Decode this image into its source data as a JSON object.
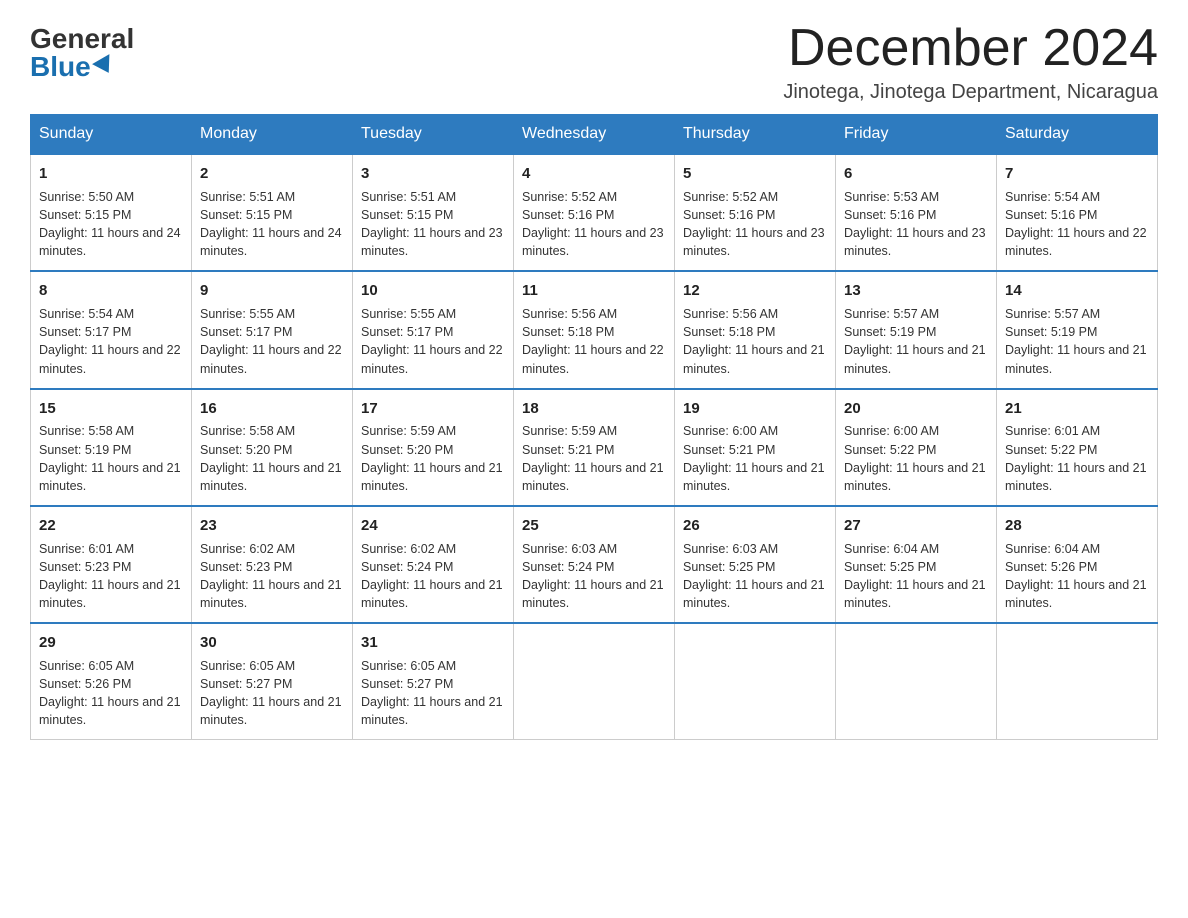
{
  "logo": {
    "general": "General",
    "blue": "Blue"
  },
  "title": "December 2024",
  "location": "Jinotega, Jinotega Department, Nicaragua",
  "days_of_week": [
    "Sunday",
    "Monday",
    "Tuesday",
    "Wednesday",
    "Thursday",
    "Friday",
    "Saturday"
  ],
  "weeks": [
    [
      {
        "day": "1",
        "sunrise": "5:50 AM",
        "sunset": "5:15 PM",
        "daylight": "11 hours and 24 minutes."
      },
      {
        "day": "2",
        "sunrise": "5:51 AM",
        "sunset": "5:15 PM",
        "daylight": "11 hours and 24 minutes."
      },
      {
        "day": "3",
        "sunrise": "5:51 AM",
        "sunset": "5:15 PM",
        "daylight": "11 hours and 23 minutes."
      },
      {
        "day": "4",
        "sunrise": "5:52 AM",
        "sunset": "5:16 PM",
        "daylight": "11 hours and 23 minutes."
      },
      {
        "day": "5",
        "sunrise": "5:52 AM",
        "sunset": "5:16 PM",
        "daylight": "11 hours and 23 minutes."
      },
      {
        "day": "6",
        "sunrise": "5:53 AM",
        "sunset": "5:16 PM",
        "daylight": "11 hours and 23 minutes."
      },
      {
        "day": "7",
        "sunrise": "5:54 AM",
        "sunset": "5:16 PM",
        "daylight": "11 hours and 22 minutes."
      }
    ],
    [
      {
        "day": "8",
        "sunrise": "5:54 AM",
        "sunset": "5:17 PM",
        "daylight": "11 hours and 22 minutes."
      },
      {
        "day": "9",
        "sunrise": "5:55 AM",
        "sunset": "5:17 PM",
        "daylight": "11 hours and 22 minutes."
      },
      {
        "day": "10",
        "sunrise": "5:55 AM",
        "sunset": "5:17 PM",
        "daylight": "11 hours and 22 minutes."
      },
      {
        "day": "11",
        "sunrise": "5:56 AM",
        "sunset": "5:18 PM",
        "daylight": "11 hours and 22 minutes."
      },
      {
        "day": "12",
        "sunrise": "5:56 AM",
        "sunset": "5:18 PM",
        "daylight": "11 hours and 21 minutes."
      },
      {
        "day": "13",
        "sunrise": "5:57 AM",
        "sunset": "5:19 PM",
        "daylight": "11 hours and 21 minutes."
      },
      {
        "day": "14",
        "sunrise": "5:57 AM",
        "sunset": "5:19 PM",
        "daylight": "11 hours and 21 minutes."
      }
    ],
    [
      {
        "day": "15",
        "sunrise": "5:58 AM",
        "sunset": "5:19 PM",
        "daylight": "11 hours and 21 minutes."
      },
      {
        "day": "16",
        "sunrise": "5:58 AM",
        "sunset": "5:20 PM",
        "daylight": "11 hours and 21 minutes."
      },
      {
        "day": "17",
        "sunrise": "5:59 AM",
        "sunset": "5:20 PM",
        "daylight": "11 hours and 21 minutes."
      },
      {
        "day": "18",
        "sunrise": "5:59 AM",
        "sunset": "5:21 PM",
        "daylight": "11 hours and 21 minutes."
      },
      {
        "day": "19",
        "sunrise": "6:00 AM",
        "sunset": "5:21 PM",
        "daylight": "11 hours and 21 minutes."
      },
      {
        "day": "20",
        "sunrise": "6:00 AM",
        "sunset": "5:22 PM",
        "daylight": "11 hours and 21 minutes."
      },
      {
        "day": "21",
        "sunrise": "6:01 AM",
        "sunset": "5:22 PM",
        "daylight": "11 hours and 21 minutes."
      }
    ],
    [
      {
        "day": "22",
        "sunrise": "6:01 AM",
        "sunset": "5:23 PM",
        "daylight": "11 hours and 21 minutes."
      },
      {
        "day": "23",
        "sunrise": "6:02 AM",
        "sunset": "5:23 PM",
        "daylight": "11 hours and 21 minutes."
      },
      {
        "day": "24",
        "sunrise": "6:02 AM",
        "sunset": "5:24 PM",
        "daylight": "11 hours and 21 minutes."
      },
      {
        "day": "25",
        "sunrise": "6:03 AM",
        "sunset": "5:24 PM",
        "daylight": "11 hours and 21 minutes."
      },
      {
        "day": "26",
        "sunrise": "6:03 AM",
        "sunset": "5:25 PM",
        "daylight": "11 hours and 21 minutes."
      },
      {
        "day": "27",
        "sunrise": "6:04 AM",
        "sunset": "5:25 PM",
        "daylight": "11 hours and 21 minutes."
      },
      {
        "day": "28",
        "sunrise": "6:04 AM",
        "sunset": "5:26 PM",
        "daylight": "11 hours and 21 minutes."
      }
    ],
    [
      {
        "day": "29",
        "sunrise": "6:05 AM",
        "sunset": "5:26 PM",
        "daylight": "11 hours and 21 minutes."
      },
      {
        "day": "30",
        "sunrise": "6:05 AM",
        "sunset": "5:27 PM",
        "daylight": "11 hours and 21 minutes."
      },
      {
        "day": "31",
        "sunrise": "6:05 AM",
        "sunset": "5:27 PM",
        "daylight": "11 hours and 21 minutes."
      },
      null,
      null,
      null,
      null
    ]
  ],
  "labels": {
    "sunrise": "Sunrise:",
    "sunset": "Sunset:",
    "daylight": "Daylight:"
  }
}
